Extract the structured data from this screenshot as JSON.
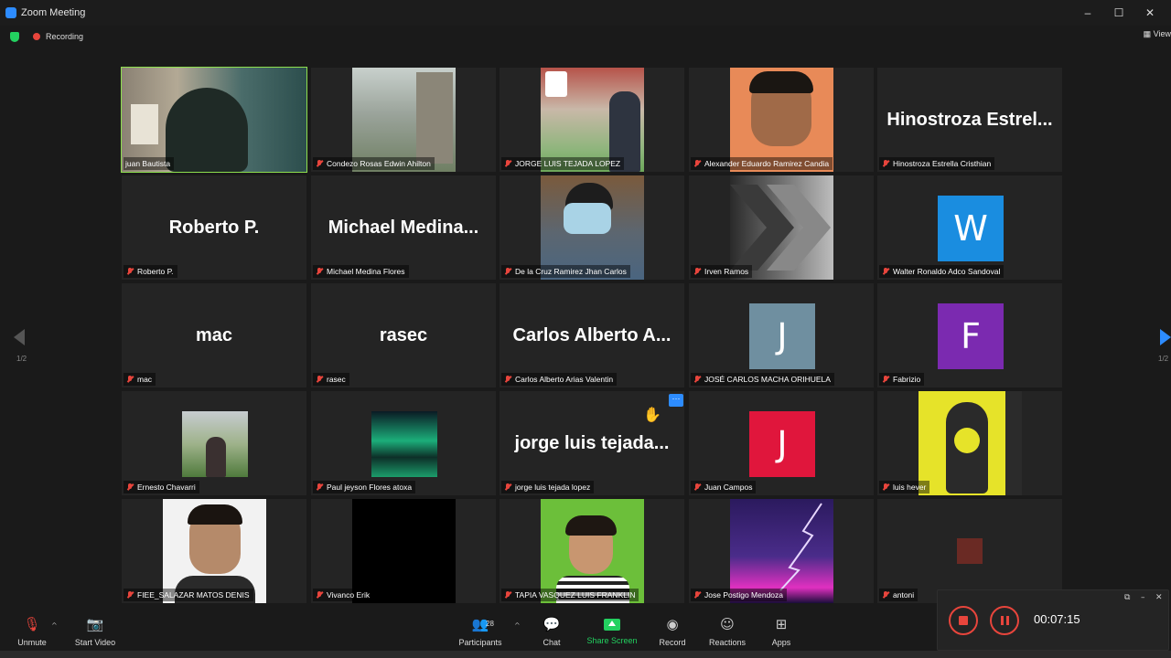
{
  "window": {
    "title": "Zoom Meeting",
    "minimize": "–",
    "maximize": "☐",
    "close": "✕"
  },
  "status": {
    "recording_label": "Recording",
    "view_label": "View"
  },
  "pagination": {
    "left": "1/2",
    "right": "1/2"
  },
  "tiles": [
    {
      "name": "juan Bautista",
      "big": ""
    },
    {
      "name": "Condezo Rosas Edwin Ahilton",
      "big": ""
    },
    {
      "name": "JORGE LUIS TEJADA LOPEZ",
      "big": ""
    },
    {
      "name": "Alexander Eduardo Ramirez Candia",
      "big": ""
    },
    {
      "name": "Hinostroza Estrella Cristhian",
      "big": "Hinostroza  Estrel..."
    },
    {
      "name": "Roberto P.",
      "big": "Roberto P."
    },
    {
      "name": "Michael Medina Flores",
      "big": "Michael  Medina..."
    },
    {
      "name": "De la Cruz Ramirez Jhan Carlos",
      "big": ""
    },
    {
      "name": "Irven Ramos",
      "big": ""
    },
    {
      "name": "Walter Ronaldo Adco Sandoval",
      "big": "",
      "avatar": "W"
    },
    {
      "name": "mac",
      "big": "mac"
    },
    {
      "name": "rasec",
      "big": "rasec"
    },
    {
      "name": "Carlos Alberto Arias Valentin",
      "big": "Carlos  Alberto  A..."
    },
    {
      "name": "JOSÉ CARLOS MACHA ORIHUELA",
      "big": "",
      "avatar": "J"
    },
    {
      "name": "Fabrizio",
      "big": "",
      "avatar": "F"
    },
    {
      "name": "Ernesto Chavarri",
      "big": ""
    },
    {
      "name": "Paul jeyson Flores atoxa",
      "big": ""
    },
    {
      "name": "jorge luis tejada lopez",
      "big": "jorge  luis  tejada..."
    },
    {
      "name": "Juan Campos",
      "big": "",
      "avatar": "J"
    },
    {
      "name": "luis hever",
      "big": ""
    },
    {
      "name": "FIEE_SALAZAR MATOS DENIS",
      "big": ""
    },
    {
      "name": "Vivanco Erik",
      "big": ""
    },
    {
      "name": "TAPIA VASQUEZ LUIS FRANKLIN",
      "big": ""
    },
    {
      "name": "Jose Postigo Mendoza",
      "big": ""
    },
    {
      "name": "antoni",
      "big": ""
    }
  ],
  "more_button": "···",
  "toolbar": {
    "unmute": "Unmute",
    "start_video": "Start Video",
    "participants": "Participants",
    "participants_count": "28",
    "chat": "Chat",
    "share_screen": "Share Screen",
    "record": "Record",
    "reactions": "Reactions",
    "apps": "Apps"
  },
  "recording_panel": {
    "elapsed": "00:07:15"
  },
  "colors": {
    "accent": "#2d8cff",
    "active_speaker": "#8ee04e",
    "recording": "#e8453c",
    "share": "#23d160"
  }
}
